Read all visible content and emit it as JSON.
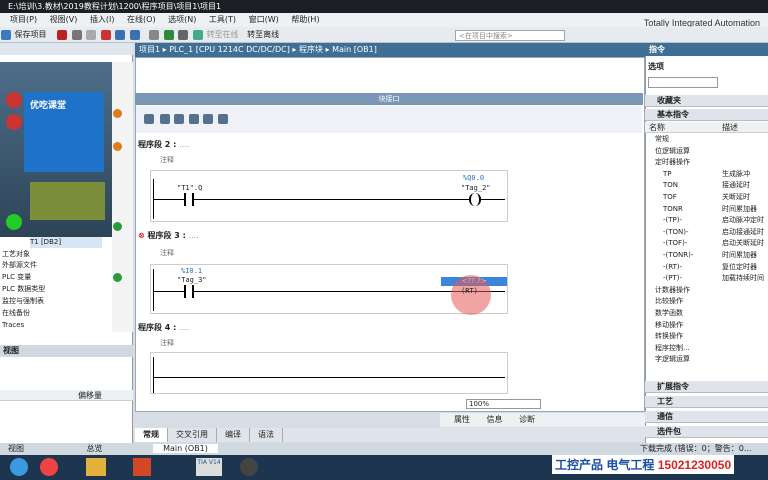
{
  "window": {
    "title": "E:\\培训\\3.教材\\2019教程计划\\1200\\程序项目\\项目1\\项目1",
    "brand": "Totally Integrated Automation"
  },
  "menu": [
    "项目(P)",
    "视图(V)",
    "插入(I)",
    "在线(O)",
    "选项(N)",
    "工具(T)",
    "窗口(W)",
    "帮助(H)"
  ],
  "toolbar": {
    "save_label": "保存项目",
    "go_offline": "转至离线",
    "go_online": "转至在线",
    "search_placeholder": "<在项目中搜索>"
  },
  "breadcrumb": [
    "项目1",
    "PLC_1 [CPU 1214C DC/DC/DC]",
    "程序块",
    "Main [OB1]"
  ],
  "left_tree": [
    "工艺对象",
    "外部源文件",
    "PLC 变量",
    "PLC 数据类型",
    "监控与强制表",
    "在线备份",
    "Traces"
  ],
  "left_device": {
    "label": "T1 [DB2]",
    "logo": "优吃课堂"
  },
  "detail": {
    "header": "视图",
    "column": "偏移量"
  },
  "block_interface": "块接口",
  "networks": [
    {
      "title": "程序段 2 :",
      "dots": "....",
      "comment": "注释",
      "contact": "\"T1\".Q",
      "coil_addr": "%Q0.0",
      "coil": "\"Tag_2\""
    },
    {
      "title": "程序段 3 :",
      "dots": "....",
      "comment": "注释",
      "contact_addr": "%I0.1",
      "contact": "\"Tag_3\"",
      "coil_placeholder": "<??.?>",
      "coil_type": "(RT)"
    },
    {
      "title": "程序段 4 :",
      "dots": "....",
      "comment": "注释"
    }
  ],
  "zoom": "100%",
  "bottom_tabs": [
    "常规",
    "交叉引用",
    "编译",
    "语法"
  ],
  "inspector": {
    "properties": "属性",
    "info": "信息",
    "diagnostics": "诊断"
  },
  "right": {
    "instructions": "指令",
    "options": "选项",
    "favorites": "收藏夹",
    "basic": "基本指令",
    "col_name": "名称",
    "col_desc": "描述",
    "extended": "扩展指令",
    "tech": "工艺",
    "comm": "通信",
    "optional": "选件包"
  },
  "instr_list": [
    {
      "n": "常规",
      "d": ""
    },
    {
      "n": "位逻辑运算",
      "d": ""
    },
    {
      "n": "定时器操作",
      "d": ""
    },
    {
      "n": "TP",
      "d": "生成脉冲"
    },
    {
      "n": "TON",
      "d": "接通延时"
    },
    {
      "n": "TOF",
      "d": "关断延时"
    },
    {
      "n": "TONR",
      "d": "时间累加器"
    },
    {
      "n": "-(TP)-",
      "d": "启动脉冲定时"
    },
    {
      "n": "-(TON)-",
      "d": "启动接通延时"
    },
    {
      "n": "-(TOF)-",
      "d": "启动关断延时"
    },
    {
      "n": "-(TONR)-",
      "d": "时间累加器"
    },
    {
      "n": "-(RT)-",
      "d": "复位定时器"
    },
    {
      "n": "-(PT)-",
      "d": "加载持续时间"
    },
    {
      "n": "计数器操作",
      "d": ""
    },
    {
      "n": "比较操作",
      "d": ""
    },
    {
      "n": "数学函数",
      "d": ""
    },
    {
      "n": "移动操作",
      "d": ""
    },
    {
      "n": "转换操作",
      "d": ""
    },
    {
      "n": "程序控制...",
      "d": ""
    },
    {
      "n": "字逻辑运算",
      "d": ""
    }
  ],
  "status": {
    "text": "下载完成 (错误：0；警告：0...",
    "taskbar_app": "Main (OB1)",
    "tia": "TIA V14"
  },
  "watermark": {
    "a": "工控产品",
    "b": "电气工程",
    "phone": "15021230050"
  },
  "colors": {
    "title_bg": "#3f6f95",
    "accent": "#1a4fa8",
    "phone": "#d22222"
  }
}
